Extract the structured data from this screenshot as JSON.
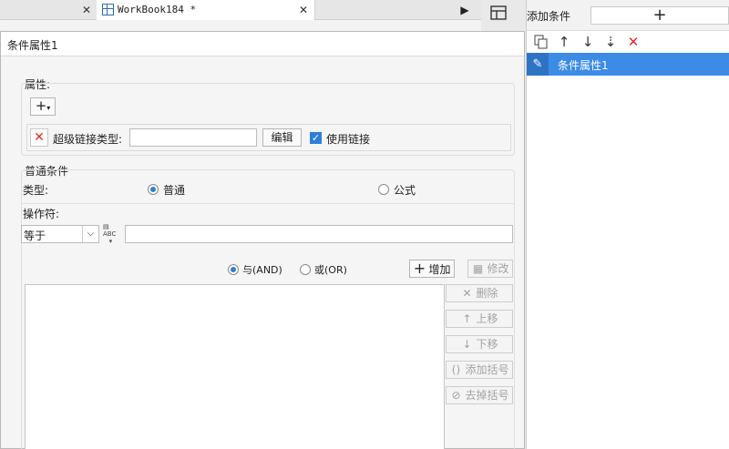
{
  "workbook_tab": {
    "title": "WorkBook184 *"
  },
  "right_panel": {
    "add_condition_label": "添加条件",
    "add_icon": "plus-icon",
    "toolbar_icons": [
      "copy-icon",
      "arrow-up-icon",
      "arrow-down-icon",
      "move-bottom-icon",
      "delete-icon"
    ],
    "selected_item": "条件属性1"
  },
  "dialog": {
    "title": "条件属性1",
    "properties": {
      "section_label": "属性:",
      "hyperlink_type_label": "超级链接类型:",
      "hyperlink_value": "",
      "edit_button": "编辑",
      "use_link_label": "使用链接",
      "use_link_checked": true
    },
    "condition": {
      "section_label": "普通条件",
      "type_label": "类型:",
      "type_options": [
        "普通",
        "公式"
      ],
      "type_selected": "普通",
      "operator_label": "操作符:",
      "operator_value": "等于",
      "value_input": "",
      "logic_and": "与(AND)",
      "logic_or": "或(OR)",
      "logic_selected": "与(AND)",
      "add_button": "增加",
      "modify_button": "修改",
      "delete_button": "删除",
      "move_up_button": "上移",
      "move_down_button": "下移",
      "add_bracket_button": "添加括号",
      "remove_bracket_button": "去掉括号"
    }
  },
  "colors": {
    "accent": "#3c8ce7",
    "delete": "#e0282e",
    "green": "#6bb420"
  }
}
